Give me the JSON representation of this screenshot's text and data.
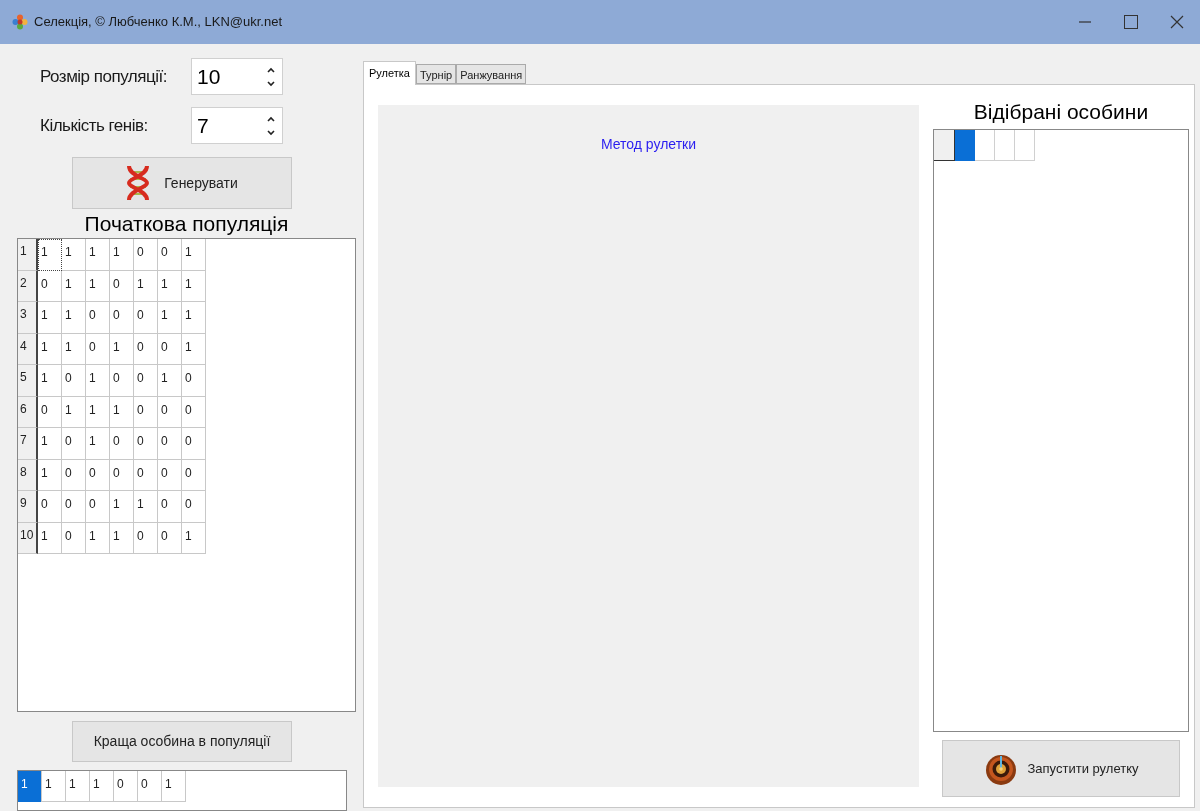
{
  "window": {
    "title": "Селекція, © Любченко К.М., LKN@ukr.net"
  },
  "population_size": {
    "label": "Розмір популяції:",
    "value": "10"
  },
  "gene_count": {
    "label": "Кількість генів:",
    "value": "7"
  },
  "generate_button": {
    "label": "Генерувати"
  },
  "initial_population": {
    "title": "Початкова популяція",
    "rows": [
      {
        "header": "1",
        "focused": true,
        "cells": [
          "1",
          "1",
          "1",
          "1",
          "0",
          "0",
          "1"
        ]
      },
      {
        "header": "2",
        "focused": false,
        "cells": [
          "0",
          "1",
          "1",
          "0",
          "1",
          "1",
          "1"
        ]
      },
      {
        "header": "3",
        "focused": false,
        "cells": [
          "1",
          "1",
          "0",
          "0",
          "0",
          "1",
          "1"
        ]
      },
      {
        "header": "4",
        "focused": false,
        "cells": [
          "1",
          "1",
          "0",
          "1",
          "0",
          "0",
          "1"
        ]
      },
      {
        "header": "5",
        "focused": false,
        "cells": [
          "1",
          "0",
          "1",
          "0",
          "0",
          "1",
          "0"
        ]
      },
      {
        "header": "6",
        "focused": false,
        "cells": [
          "0",
          "1",
          "1",
          "1",
          "0",
          "0",
          "0"
        ]
      },
      {
        "header": "7",
        "focused": false,
        "cells": [
          "1",
          "0",
          "1",
          "0",
          "0",
          "0",
          "0"
        ]
      },
      {
        "header": "8",
        "focused": false,
        "cells": [
          "1",
          "0",
          "0",
          "0",
          "0",
          "0",
          "0"
        ]
      },
      {
        "header": "9",
        "focused": false,
        "cells": [
          "0",
          "0",
          "0",
          "1",
          "1",
          "0",
          "0"
        ]
      },
      {
        "header": "10",
        "focused": false,
        "cells": [
          "1",
          "0",
          "1",
          "1",
          "0",
          "0",
          "1"
        ]
      }
    ]
  },
  "best_button": {
    "label": "Краща особина в популяції"
  },
  "best_individual": {
    "cells": [
      {
        "value": "1",
        "selected": true
      },
      {
        "value": "1",
        "selected": false
      },
      {
        "value": "1",
        "selected": false
      },
      {
        "value": "1",
        "selected": false
      },
      {
        "value": "0",
        "selected": false
      },
      {
        "value": "0",
        "selected": false
      },
      {
        "value": "1",
        "selected": false
      }
    ]
  },
  "tabs": [
    {
      "label": "Рулетка",
      "selected": true
    },
    {
      "label": "Турнір",
      "selected": false
    },
    {
      "label": "Ранжування",
      "selected": false
    }
  ],
  "method_label": "Метод рулетки",
  "selected_individuals": {
    "title": "Відібрані особини",
    "cells": [
      {
        "selected": true
      },
      {
        "selected": false
      },
      {
        "selected": false
      },
      {
        "selected": false
      }
    ]
  },
  "run_button": {
    "label": "Запустити рулетку"
  }
}
